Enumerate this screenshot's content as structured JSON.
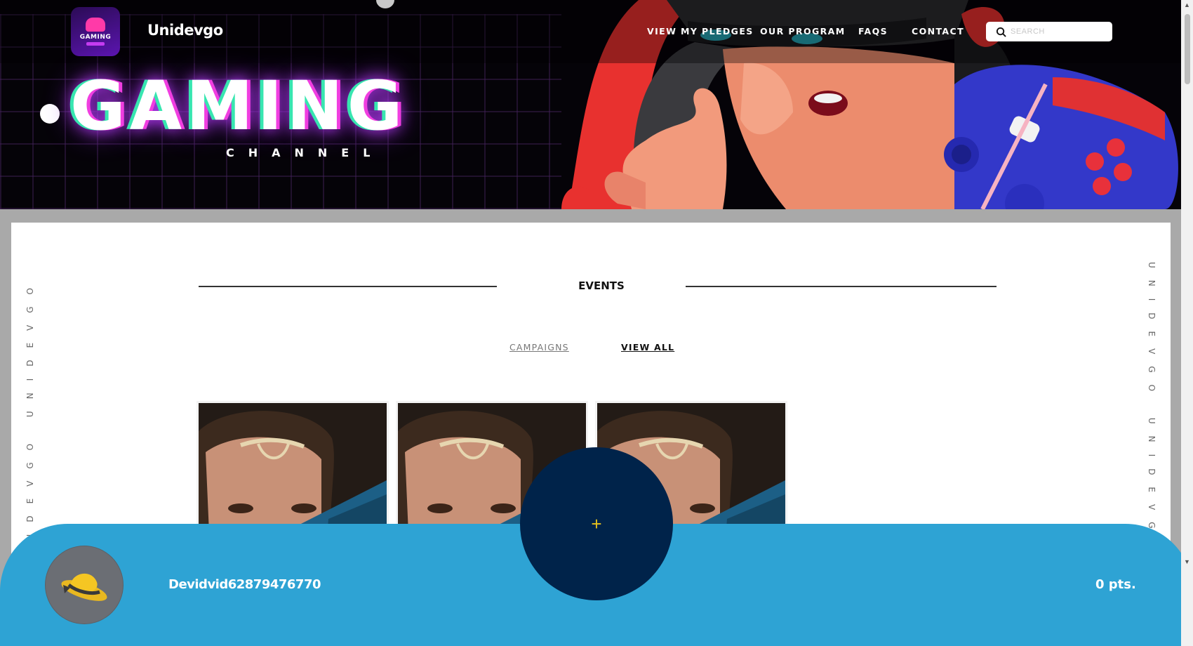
{
  "header": {
    "brand": "Unidevgo",
    "logo_text": "GAMING",
    "nav": [
      "VIEW MY PLEDGES",
      "OUR PROGRAM",
      "FAQS",
      "CONTACT"
    ],
    "search_placeholder": "SEARCH",
    "hero_title": "GAMING",
    "hero_subtitle": "CHANNEL"
  },
  "content": {
    "side_text": "UNIDEVGO UNIDEVGO",
    "section_title": "EVENTS",
    "tabs": [
      "CAMPAIGNS",
      "VIEW ALL"
    ],
    "cards": 3
  },
  "bottom_bar": {
    "username": "Devidvid62879476770",
    "points": "0 pts.",
    "fab_icon": "+"
  },
  "colors": {
    "hero_bg": "#050308",
    "bottom_bar": "#2ea3d4",
    "fab": "#00234a",
    "fab_icon": "#e6c21d",
    "accent_magenta": "#f03ee0",
    "accent_teal": "#37e6b0"
  }
}
